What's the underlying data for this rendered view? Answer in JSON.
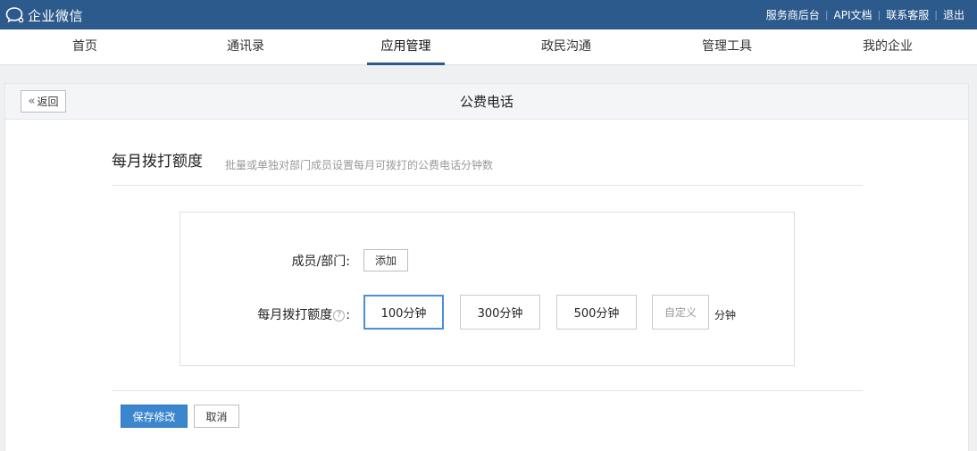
{
  "brand": {
    "name": "企业微信",
    "icon": "wecom-logo-icon"
  },
  "top_links": [
    "服务商后台",
    "API文档",
    "联系客服",
    "退出"
  ],
  "nav_tabs": [
    {
      "label": "首页",
      "active": false
    },
    {
      "label": "通讯录",
      "active": false
    },
    {
      "label": "应用管理",
      "active": true
    },
    {
      "label": "政民沟通",
      "active": false
    },
    {
      "label": "管理工具",
      "active": false
    },
    {
      "label": "我的企业",
      "active": false
    }
  ],
  "page": {
    "back_label": "返回",
    "back_icon": "double-chevron-left-icon",
    "title": "公费电话"
  },
  "section": {
    "title": "每月拨打额度",
    "description": "批量或单独对部门成员设置每月可拨打的公费电话分钟数"
  },
  "form": {
    "member_label": "成员/部门:",
    "add_label": "添加",
    "quota_label_prefix": "每月拨打额度",
    "quota_help_icon": "question-circle-icon",
    "quota_label_suffix": ":",
    "options": [
      "100分钟",
      "300分钟",
      "500分钟"
    ],
    "selected_option": "100分钟",
    "custom_placeholder": "自定义",
    "custom_value": "",
    "unit": "分钟"
  },
  "actions": {
    "save_label": "保存修改",
    "cancel_label": "取消"
  },
  "colors": {
    "topbar": "#2d5a8c",
    "primary_button": "#3b87cf",
    "selected_border": "#4a8fdb"
  }
}
